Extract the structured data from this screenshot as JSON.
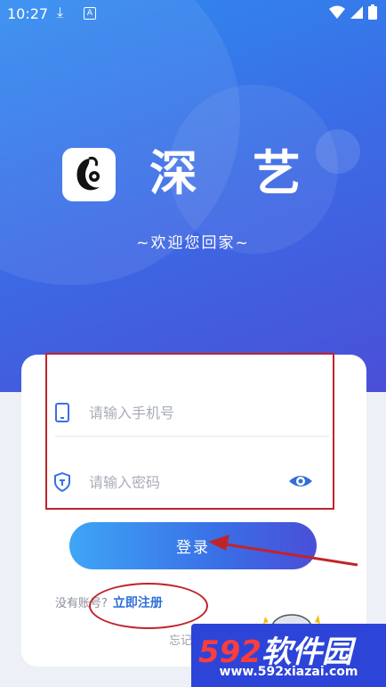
{
  "status_bar": {
    "time": "10:27",
    "download_icon": "download-icon",
    "a_icon": "A"
  },
  "app": {
    "title": "深艺",
    "subtitle": "~欢迎您回家~"
  },
  "login_form": {
    "phone_placeholder": "请输入手机号",
    "password_placeholder": "请输入密码",
    "login_button": "登录",
    "no_account_text": "没有账号?",
    "register_link": "立即注册",
    "forgot_text": "忘记"
  },
  "watermark": {
    "brand_num": "592",
    "brand_text": "软件园",
    "url": "www.592xiazai.com"
  },
  "colors": {
    "accent": "#2f6fd8",
    "annotation": "#c0242b",
    "hero_start": "#2f8bf0",
    "hero_end": "#4a4fd8"
  }
}
